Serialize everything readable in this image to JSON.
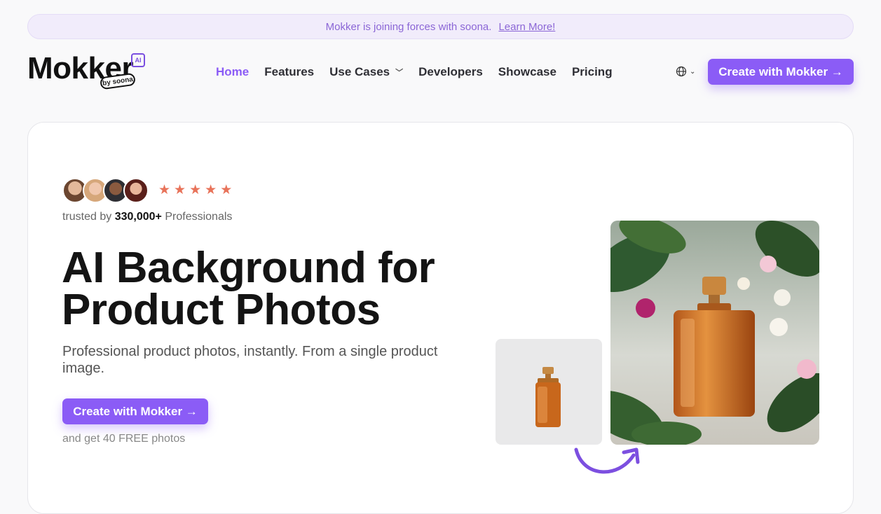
{
  "banner": {
    "text": "Mokker is joining forces with soona.",
    "link": "Learn More!"
  },
  "logo": {
    "word": "Mokker",
    "badge": "AI",
    "sub": "by soona"
  },
  "nav": {
    "items": [
      "Home",
      "Features",
      "Use Cases",
      "Developers",
      "Showcase",
      "Pricing"
    ],
    "active": "Home"
  },
  "header_cta": "Create with Mokker →",
  "hero": {
    "rating_stars": 5,
    "trusted_prefix": "trusted by",
    "trusted_count": "330,000+",
    "trusted_suffix": "Professionals",
    "title_line1": "AI Background for",
    "title_line2": "Product Photos",
    "subtitle": "Professional product photos, instantly. From a single product image.",
    "cta": "Create with Mokker →",
    "free_note": "and get 40 FREE photos"
  },
  "colors": {
    "accent": "#8b5cf6",
    "star": "#e8735a",
    "banner_bg": "#f1ecfb"
  },
  "icons": [
    "globe-icon",
    "chevron-down-icon",
    "star-icon",
    "curved-arrow-icon"
  ]
}
